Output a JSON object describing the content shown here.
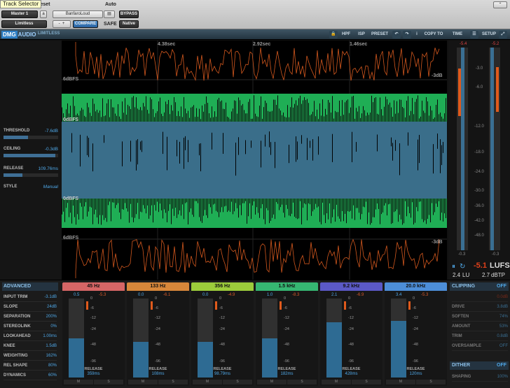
{
  "header": {
    "tooltip": "Track Selector",
    "track": "Master 1",
    "track_mode": "a",
    "insert": "Limitless",
    "preset_label": "Preset",
    "preset_name": "BanfaroLoud",
    "auto_label": "Auto",
    "bypass": "BYPASS",
    "compare": "COMPARE",
    "safe": "SAFE",
    "native": "Native",
    "plus": "+",
    "minus": "-"
  },
  "plugin": {
    "brand": "DMG",
    "brand2": "AUDIO",
    "product": "LIMITLESS",
    "toolbar": [
      "HPF",
      "ISP",
      "PRESET",
      "COPY TO",
      "TIME",
      "SETUP"
    ],
    "toolbar_icons": [
      "lock-icon",
      "undo-icon",
      "redo-icon",
      "info-icon",
      "menu-icon"
    ]
  },
  "display": {
    "times": [
      "4.38sec",
      "2.92sec",
      "1.46sec"
    ],
    "top_dbfs": "6dBFS",
    "bottom_dbfs": "6dBFS",
    "mid_dbfs": [
      "0dBFS",
      "0dBFS"
    ],
    "right_db_top": "-3dB",
    "right_db_bottom": "-3dB"
  },
  "left_controls": [
    {
      "label": "THRESHOLD",
      "value": "-7.6dB",
      "level": 0.45
    },
    {
      "label": "CEILING",
      "value": "-0.3dB",
      "level": 0.95
    },
    {
      "label": "RELEASE",
      "value": "109.76ms",
      "level": 0.35
    },
    {
      "label": "STYLE",
      "value": "Manual",
      "level": null
    }
  ],
  "meters": {
    "peak_left": "-5.4",
    "peak_right": "-5.2",
    "scale": [
      "-3.0",
      "-6.0",
      "-12.0",
      "-18.0",
      "-24.0",
      "-30.0",
      "-36.0",
      "-42.0",
      "-48.0"
    ],
    "bottom_left": "-0.3",
    "bottom_right": "-0.3",
    "lufs_value": "-5.1",
    "lufs_unit": "LUFS",
    "lu_value": "2.4",
    "lu_unit": "LU",
    "dbtp_value": "2.7",
    "dbtp_unit": "dBTP",
    "colors": {
      "orange": "#e05a1c",
      "blue": "#2e6b93"
    }
  },
  "advanced": {
    "title": "ADVANCED",
    "rows": [
      {
        "label": "INPUT TRIM",
        "value": "-3.1dB"
      },
      {
        "label": "SLOPE",
        "value": "24dB"
      },
      {
        "label": "SEPARATION",
        "value": "200%"
      },
      {
        "label": "STEREOLINK",
        "value": "0%"
      },
      {
        "label": "LOOKAHEAD",
        "value": "1.00ms"
      },
      {
        "label": "KNEE",
        "value": "1.5dB"
      },
      {
        "label": "WEIGHTING",
        "value": "162%"
      },
      {
        "label": "REL SHAPE",
        "value": "80%"
      },
      {
        "label": "DYNAMICS",
        "value": "60%"
      }
    ]
  },
  "bands": [
    {
      "name": "45 Hz",
      "color": "#d66666",
      "in": "0.5",
      "gr": "-5.3",
      "release": "359ms",
      "fill": 0.5
    },
    {
      "name": "133 Hz",
      "color": "#d7873a",
      "in": "0.0",
      "gr": "-6.1",
      "release": "108ms",
      "fill": 0.45
    },
    {
      "name": "356 Hz",
      "color": "#9ccc3b",
      "in": "0.0",
      "gr": "-4.9",
      "release": "98.79ms",
      "fill": 0.45
    },
    {
      "name": "1.5 kHz",
      "color": "#36b672",
      "in": "1.0",
      "gr": "-8.3",
      "release": "182ms",
      "fill": 0.5
    },
    {
      "name": "9.2 kHz",
      "color": "#5b59c6",
      "in": "2.1",
      "gr": "-6.9",
      "release": "428ms",
      "fill": 0.7
    },
    {
      "name": "20.0 kHz",
      "color": "#4d8ed8",
      "in": "3.4",
      "gr": "-5.3",
      "release": "120ms",
      "fill": 0.72
    }
  ],
  "band_scale": [
    "0",
    "-6",
    "-12",
    "-24",
    "-48",
    "-96"
  ],
  "band_release_label": "RELEASE",
  "band_ms": [
    "M",
    "S"
  ],
  "clipping": {
    "title": "CLIPPING",
    "state": "OFF",
    "rows": [
      {
        "label": "",
        "value": "0.0dB"
      },
      {
        "label": "DRIVE",
        "value": "3.8dB"
      },
      {
        "label": "SOFTEN",
        "value": "74%"
      },
      {
        "label": "AMOUNT",
        "value": "53%"
      },
      {
        "label": "TRIM",
        "value": "0.8dB"
      },
      {
        "label": "OVERSAMPLE",
        "value": "OFF"
      }
    ]
  },
  "dither": {
    "title": "DITHER",
    "state": "OFF",
    "rows": [
      {
        "label": "SHAPING",
        "value": "100%"
      }
    ]
  }
}
